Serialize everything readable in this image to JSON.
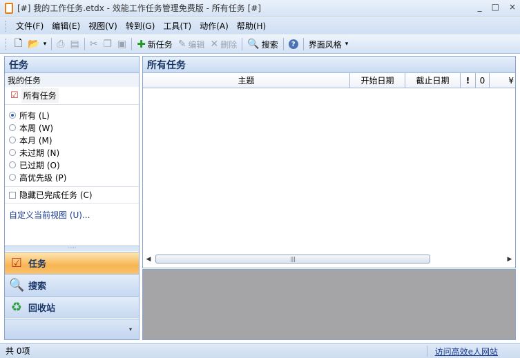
{
  "window": {
    "title": "[#] 我的工作任务.etdx - 效能工作任务管理免费版 - 所有任务 [#]",
    "buttons": [
      "_",
      "□",
      "×"
    ]
  },
  "menu": [
    "文件(F)",
    "编辑(E)",
    "视图(V)",
    "转到(G)",
    "工具(T)",
    "动作(A)",
    "帮助(H)"
  ],
  "toolbar": {
    "new_task": "新任务",
    "edit": "编辑",
    "delete": "删除",
    "search": "搜索",
    "theme": "界面风格"
  },
  "left_pane": {
    "header": "任务",
    "section": "我的任务",
    "all_tasks": "所有任务",
    "filters": [
      {
        "label": "所有 (L)",
        "checked": true
      },
      {
        "label": "本周 (W)",
        "checked": false
      },
      {
        "label": "本月 (M)",
        "checked": false
      },
      {
        "label": "未过期 (N)",
        "checked": false
      },
      {
        "label": "已过期 (O)",
        "checked": false
      },
      {
        "label": "高优先级 (P)",
        "checked": false
      }
    ],
    "hide_completed": "隐藏已完成任务 (C)",
    "customize_view": "自定义当前视图 (U)..."
  },
  "nav": {
    "tasks": "任务",
    "search": "搜索",
    "recycle": "回收站"
  },
  "main": {
    "header": "所有任务",
    "columns": [
      "主题",
      "开始日期",
      "截止日期",
      "!",
      "0",
      "¥"
    ]
  },
  "status": {
    "count": "共 0项",
    "link": "访问高效e人网站"
  }
}
